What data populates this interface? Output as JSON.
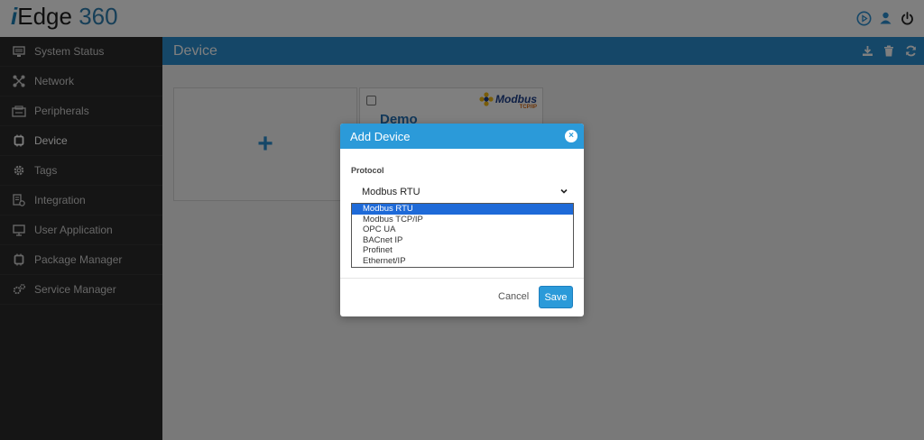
{
  "brand": {
    "prefix": "i",
    "name": "Edge",
    "number": "360"
  },
  "topbar": {
    "icons": [
      "play-circle-icon",
      "user-icon",
      "power-icon"
    ]
  },
  "sidebar": {
    "items": [
      {
        "label": "System Status",
        "icon": "monitor-icon"
      },
      {
        "label": "Network",
        "icon": "network-icon"
      },
      {
        "label": "Peripherals",
        "icon": "peripherals-icon"
      },
      {
        "label": "Device",
        "icon": "chip-icon",
        "active": true
      },
      {
        "label": "Tags",
        "icon": "gear-icon"
      },
      {
        "label": "Integration",
        "icon": "integration-icon"
      },
      {
        "label": "User Application",
        "icon": "desktop-icon"
      },
      {
        "label": "Package Manager",
        "icon": "package-icon"
      },
      {
        "label": "Service Manager",
        "icon": "gears-icon"
      }
    ]
  },
  "main": {
    "title": "Device",
    "header_icons": [
      "download-icon",
      "trash-icon",
      "refresh-icon"
    ],
    "add_card": {
      "symbol": "+"
    },
    "device_card": {
      "name": "Demo",
      "logo_text": "Modbus",
      "logo_sub": "TCP/IP"
    }
  },
  "modal": {
    "title": "Add Device",
    "close_symbol": "×",
    "protocol_label": "Protocol",
    "protocol_value": "Modbus RTU",
    "options": [
      "Modbus RTU",
      "Modbus TCP/IP",
      "OPC UA",
      "BACnet IP",
      "Profinet",
      "Ethernet/IP"
    ],
    "cancel_label": "Cancel",
    "save_label": "Save"
  },
  "colors": {
    "accent": "#2b9ad9",
    "header_blue": "#2b8fd0",
    "sidebar_bg": "#2b2b2b",
    "selection": "#1e6ad8"
  }
}
